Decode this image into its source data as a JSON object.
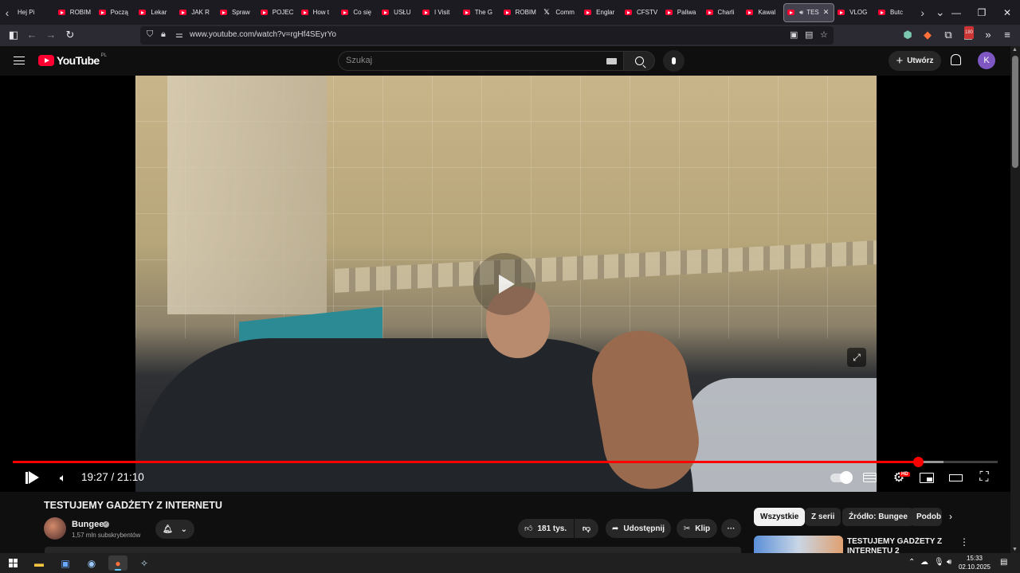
{
  "browser": {
    "tabs": [
      {
        "label": "Hej Pi",
        "icon": "none"
      },
      {
        "label": "ROBIM",
        "icon": "youtube-icon"
      },
      {
        "label": "Począ",
        "icon": "youtube-icon"
      },
      {
        "label": "Lekar",
        "icon": "youtube-icon"
      },
      {
        "label": "JAK R",
        "icon": "youtube-icon"
      },
      {
        "label": "Spraw",
        "icon": "youtube-icon"
      },
      {
        "label": "POJEC",
        "icon": "youtube-icon"
      },
      {
        "label": "How t",
        "icon": "youtube-icon"
      },
      {
        "label": "Co się",
        "icon": "youtube-icon"
      },
      {
        "label": "USŁU",
        "icon": "youtube-icon"
      },
      {
        "label": "I Visit",
        "icon": "youtube-icon"
      },
      {
        "label": "The G",
        "icon": "youtube-icon"
      },
      {
        "label": "ROBIM",
        "icon": "youtube-icon"
      },
      {
        "label": "Comm",
        "icon": "x-icon"
      },
      {
        "label": "Englar",
        "icon": "youtube-icon"
      },
      {
        "label": "CFSTV",
        "icon": "youtube-icon"
      },
      {
        "label": "Paliwa",
        "icon": "youtube-icon"
      },
      {
        "label": "Charli",
        "icon": "youtube-icon"
      },
      {
        "label": "Kawal",
        "icon": "youtube-icon"
      },
      {
        "label": "TES",
        "icon": "youtube-icon",
        "active": true
      },
      {
        "label": "VLOG",
        "icon": "youtube-icon"
      },
      {
        "label": "Butc",
        "icon": "youtube-icon"
      }
    ],
    "url": "www.youtube.com/watch?v=rgHf4SEyrYo",
    "extension_badge": "180"
  },
  "youtube": {
    "logo_text": "YouTube",
    "country_code": "PL",
    "search_placeholder": "Szukaj",
    "create_label": "Utwórz",
    "avatar_letter": "K"
  },
  "player": {
    "current_time": "19:27",
    "duration": "21:10",
    "time_display": "19:27 / 21:10",
    "played_fraction": 0.919,
    "buffered_fraction": 0.945,
    "quality_badge": "HD"
  },
  "video": {
    "title": "TESTUJEMY GADŻETY Z INTERNETU",
    "channel_name": "Bungee",
    "subscribers": "1,57 mln subskrybentów",
    "likes": "181 tys.",
    "share_label": "Udostępnij",
    "clip_label": "Klip",
    "more_label": "···"
  },
  "recommendations": {
    "chips": [
      "Wszystkie",
      "Z serii",
      "Źródło: Bungee",
      "Podob"
    ],
    "first_title": "TESTUJEMY GADŻETY Z INTERNETU 2"
  },
  "taskbar": {
    "time": "15:33",
    "date": "02.10.2025"
  },
  "colors": {
    "youtube_red": "#ff0033",
    "progress_red": "#ff0000",
    "background": "#0f0f0f",
    "avatar_purple": "#7e57c2"
  }
}
